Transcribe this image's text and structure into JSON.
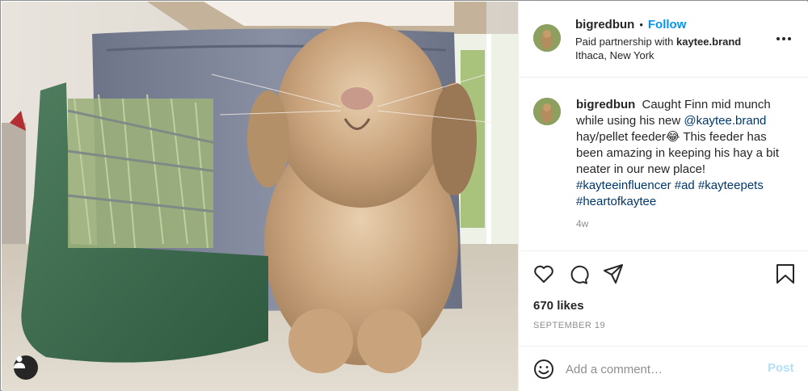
{
  "post": {
    "username": "bigredbun",
    "separator": "•",
    "follow_label": "Follow",
    "partnership_prefix": "Paid partnership with",
    "partner": "kaytee.brand",
    "location": "Ithaca, New York",
    "caption": {
      "username": "bigredbun",
      "text_1": "Caught Finn mid munch while using his new",
      "mention": "@kaytee.brand",
      "text_2": "hay/pellet feeder😂 This feeder has been amazing in keeping his hay a bit neater in our new place!",
      "hashtag_1": "#kayteeinfluencer",
      "hashtag_2": "#ad",
      "hashtag_3": "#kayteepets",
      "hashtag_4": "#heartofkaytee"
    },
    "age": "4w",
    "likes": "670 likes",
    "date": "SEPTEMBER 19"
  },
  "comment_box": {
    "placeholder": "Add a comment…",
    "post_label": "Post"
  },
  "icons": {
    "more": "more-options-icon",
    "like": "heart-icon",
    "comment": "comment-icon",
    "share": "share-icon",
    "save": "bookmark-icon",
    "emoji": "emoji-icon",
    "tags": "user-tag-icon"
  },
  "colors": {
    "accent": "#0095f6",
    "link": "#00376b",
    "muted": "#8e8e8e",
    "post_disabled": "#b2dffc"
  }
}
